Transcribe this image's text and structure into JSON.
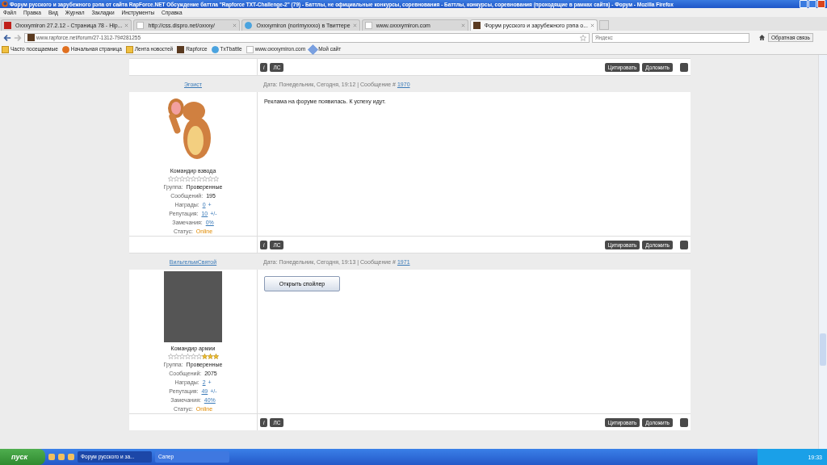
{
  "window": {
    "title": "Форум русского и зарубежного рэпа от сайта RapForce.NET Обсуждение баттла \"Rapforce TXT-Challenge-2\" (79) - Баттлы, не официальные конкурсы, соревнования - Баттлы, конкурсы, соревнования (проходящие в рамках сайта) - Форум - Mozilla Firefox"
  },
  "menu": [
    "Файл",
    "Правка",
    "Вид",
    "Журнал",
    "Закладки",
    "Инструменты",
    "Справка"
  ],
  "tabs": [
    {
      "label": "Oxxxymiron 27.2.12 - Страница 78 - Hip...",
      "selected": false,
      "kind": "red"
    },
    {
      "label": "http://css.dispro.net/oxxxy/",
      "selected": false,
      "kind": "blank"
    },
    {
      "label": "Oxxxymiron (norimyxxxo) в Твиттере",
      "selected": false,
      "kind": "bird"
    },
    {
      "label": "www.oxxxymiron.com",
      "selected": false,
      "kind": "blank"
    },
    {
      "label": "Форум русского и зарубежного рэпа о...",
      "selected": true,
      "kind": "site"
    }
  ],
  "address": {
    "url": "www.rapforce.net/forum/27-1312-79#281255"
  },
  "search": {
    "placeholder": "Яндекс"
  },
  "feedback_button": "Обратная связь",
  "bookmarks": [
    {
      "label": "Часто посещаемые",
      "kind": "folder"
    },
    {
      "label": "Начальная страница",
      "kind": "fox"
    },
    {
      "label": "Лента новостей",
      "kind": "folder"
    },
    {
      "label": "Rapforce",
      "kind": "site"
    },
    {
      "label": "TxTbattle",
      "kind": "bird"
    },
    {
      "label": "www.oxxxymiron.com",
      "kind": "blank"
    },
    {
      "label": "Мой сайт",
      "kind": "star"
    }
  ],
  "top_actions": {
    "info": "i",
    "pm": "ЛС",
    "quote": "Цитировать",
    "report": "Доложить"
  },
  "posts": [
    {
      "author": "Эгоист",
      "date": "Дата: Понедельник, Сегодня, 19:12 | Сообщение #",
      "number": "1970",
      "avatar": {
        "kind": "cartoon"
      },
      "rank": "Командир взвода",
      "stars": 0,
      "stats": [
        {
          "label": "Группа:",
          "value": "Проверенные",
          "kind": "plain"
        },
        {
          "label": "Сообщений:",
          "value": "195",
          "kind": "plain"
        },
        {
          "label": "Награды:",
          "value": "0",
          "extra": "+",
          "kind": "link"
        },
        {
          "label": "Репутация:",
          "value": "10",
          "extra": "+/-",
          "kind": "link"
        },
        {
          "label": "Замечания:",
          "value": "0%",
          "kind": "link"
        },
        {
          "label": "Статус:",
          "value": "Online",
          "kind": "status"
        }
      ],
      "body": {
        "kind": "text",
        "text": "Реклама на форуме появилась. К успеху идут."
      },
      "actions": {
        "info": "i",
        "pm": "ЛС",
        "quote": "Цитировать",
        "report": "Доложить"
      }
    },
    {
      "author": "ВильгельмСвятой",
      "date": "Дата: Понедельник, Сегодня, 19:13 | Сообщение #",
      "number": "1971",
      "avatar": {
        "kind": "photo"
      },
      "rank": "Командир армии",
      "stars": 3,
      "stats": [
        {
          "label": "Группа:",
          "value": "Проверенные",
          "kind": "plain"
        },
        {
          "label": "Сообщений:",
          "value": "2075",
          "kind": "plain"
        },
        {
          "label": "Награды:",
          "value": "2",
          "extra": "+",
          "kind": "link"
        },
        {
          "label": "Репутация:",
          "value": "49",
          "extra": "+/-",
          "kind": "link"
        },
        {
          "label": "Замечания:",
          "value": "40%",
          "kind": "link"
        },
        {
          "label": "Статус:",
          "value": "Online",
          "kind": "status"
        }
      ],
      "body": {
        "kind": "spoiler",
        "text": "Открыть спойлер"
      },
      "actions": {
        "info": "i",
        "pm": "ЛС",
        "quote": "Цитировать",
        "report": "Доложить"
      }
    }
  ],
  "taskbar": {
    "start": "пуск",
    "tasks": [
      {
        "label": "Форум русского и за...",
        "selected": true
      },
      {
        "label": "Сапер",
        "selected": false
      }
    ],
    "clock": "19:33"
  }
}
